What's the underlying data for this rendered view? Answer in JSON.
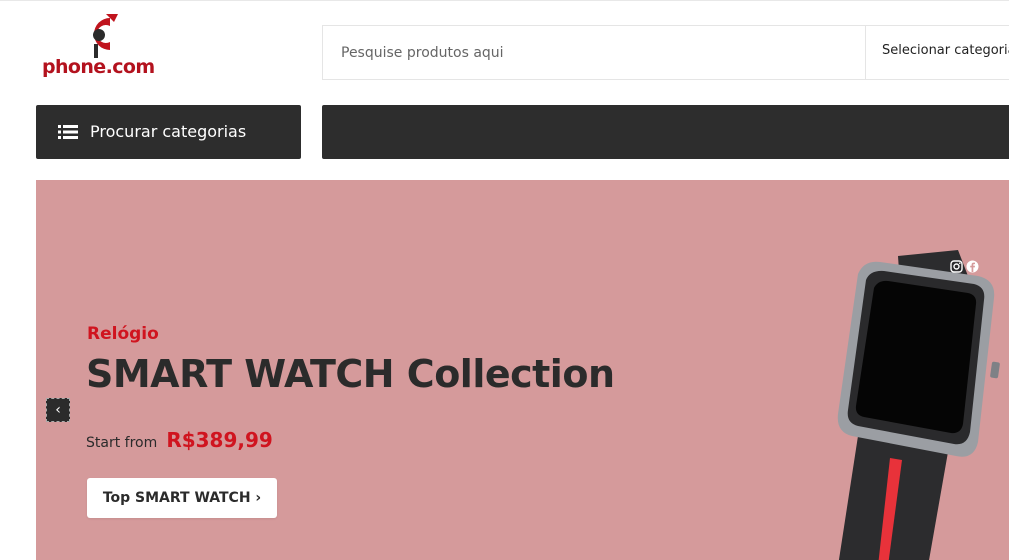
{
  "header": {
    "logo_text": "phone.com",
    "search": {
      "placeholder": "Pesquise produtos aqui",
      "category_select": "Selecionar categoria"
    }
  },
  "nav": {
    "categories_button": "Procurar categorias"
  },
  "hero": {
    "kicker": "Relógio",
    "title": "SMART WATCH Collection",
    "price_prefix": "Start from",
    "price": "R$389,99",
    "cta": "Top SMART WATCH ›",
    "prev_arrow": "‹"
  },
  "colors": {
    "brand_red": "#d0141f",
    "dark_bar": "#2d2d2d",
    "hero_bg": "#d59a9b"
  },
  "icons": [
    "list-icon",
    "chevron-left-icon",
    "instagram-icon",
    "facebook-icon"
  ]
}
